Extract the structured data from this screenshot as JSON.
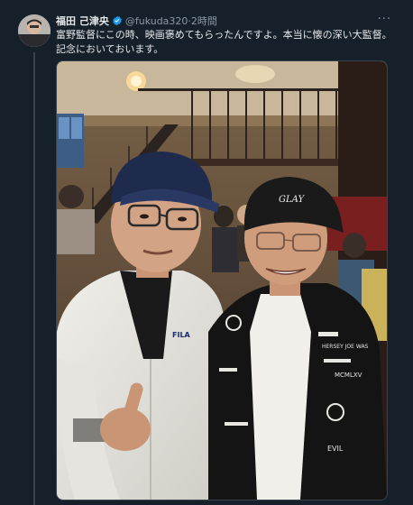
{
  "tweet": {
    "author_name": "福田 己津央",
    "handle": "@fukuda320",
    "separator": "·",
    "time": "2時間",
    "verified": true,
    "text_lines": [
      "富野監督にこの時、映画褒めてもらったんですよ。本当に懐の深い大監督。",
      "記念においておいます。"
    ],
    "icons": {
      "avatar": "profile-avatar",
      "verified": "verified-badge-icon",
      "more": "more-options-icon"
    }
  },
  "colors": {
    "background": "#15202b",
    "text": "#e7e9ea",
    "secondary_text": "#8b98a5",
    "verified": "#1d9bf0",
    "border": "#38444d"
  },
  "media": {
    "photo_text": {
      "cap_logo": "GLAY",
      "shirt_brand": "FILA",
      "jacket_text_1": "HERSEY JOE WAS",
      "jacket_text_2": "MCMLXV",
      "jacket_text_3": "EVIL"
    }
  }
}
